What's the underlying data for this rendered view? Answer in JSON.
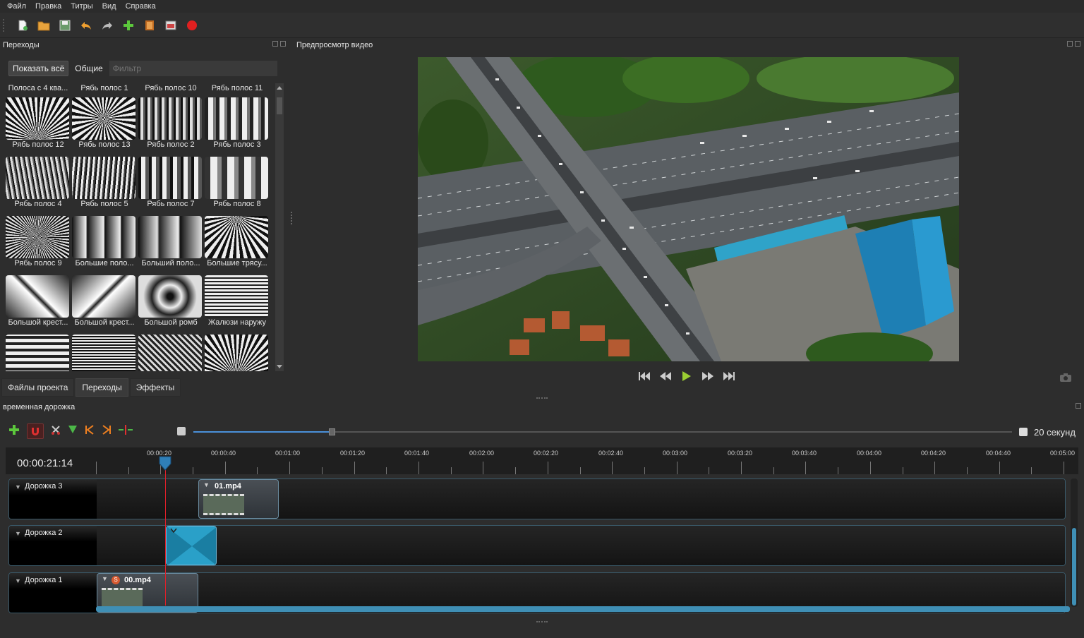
{
  "menu": [
    "Файл",
    "Правка",
    "Титры",
    "Вид",
    "Справка"
  ],
  "toolbar": {
    "icons": [
      "new-project-icon",
      "open-project-icon",
      "save-project-icon",
      "undo-icon",
      "redo-icon",
      "import-files-icon",
      "profile-icon",
      "fullscreen-icon",
      "export-record-icon"
    ]
  },
  "transitions_panel": {
    "title": "Переходы",
    "show_all": "Показать всё",
    "common": "Общие",
    "filter_placeholder": "Фильтр",
    "items": [
      "Полоса с 4 ква...",
      "Рябь полос 1",
      "Рябь полос 10",
      "Рябь полос 11",
      "Рябь полос 12",
      "Рябь полос 13",
      "Рябь полос 2",
      "Рябь полос 3",
      "Рябь полос 4",
      "Рябь полос 5",
      "Рябь полос 7",
      "Рябь полос 8",
      "Рябь полос 9",
      "Большие поло...",
      "Больший поло...",
      "Большие трясу...",
      "Большой крест...",
      "Большой крест...",
      "Большой ромб",
      "Жалюзи наружу"
    ],
    "tabs": [
      "Файлы проекта",
      "Переходы",
      "Эффекты"
    ],
    "active_tab": "Переходы"
  },
  "preview": {
    "title": "Предпросмотр видео"
  },
  "timeline": {
    "title": "временная дорожка",
    "zoom_label": "20 секунд",
    "timecode": "00:00:21:14",
    "ruler_labels": [
      "00:00:20",
      "00:00:40",
      "00:01:00",
      "00:01:20",
      "00:01:40",
      "00:02:00",
      "00:02:20",
      "00:02:40",
      "00:03:00",
      "00:03:20",
      "00:03:40",
      "00:04:00",
      "00:04:20",
      "00:04:40",
      "00:05:00"
    ],
    "tracks": [
      {
        "name": "Дорожка 3",
        "clip": "01.mp4"
      },
      {
        "name": "Дорожка 2",
        "clip": ""
      },
      {
        "name": "Дорожка 1",
        "clip": "00.mp4"
      }
    ],
    "clip_badge": "S"
  },
  "colors": {
    "accent_blue": "#3f8fb5",
    "playhead_red": "#e0202a",
    "record_red": "#e02020",
    "play_green": "#9acd32"
  }
}
